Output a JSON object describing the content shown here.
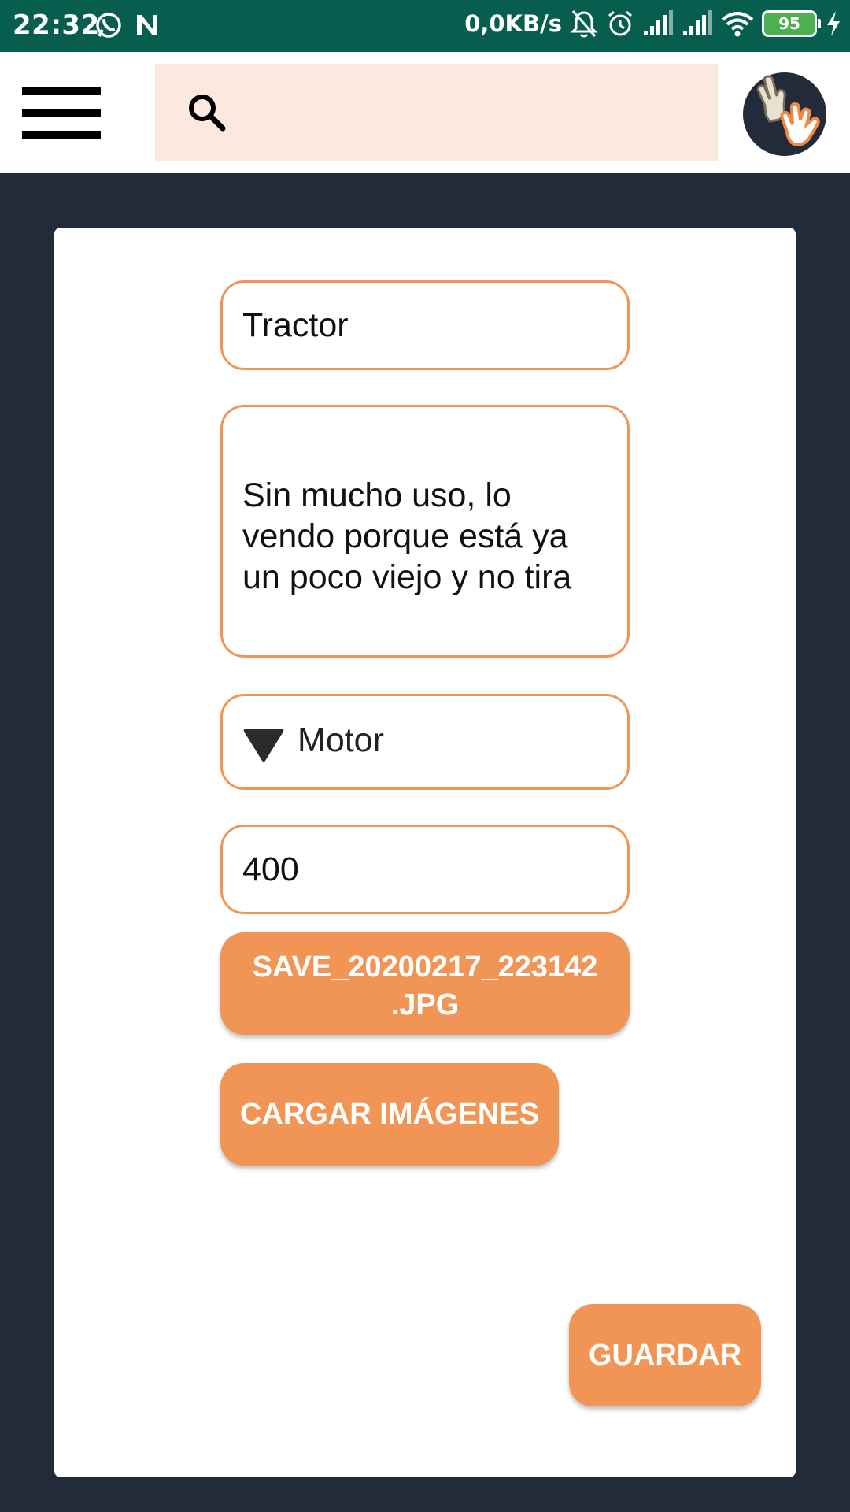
{
  "status_bar": {
    "time": "22:32",
    "network_speed": "0,0KB/s",
    "battery_level": "95",
    "icons": [
      "whatsapp-icon",
      "n-app-icon",
      "bell-off-icon",
      "alarm-icon",
      "signal-icon",
      "signal-icon",
      "wifi-icon",
      "battery-icon",
      "charging-icon"
    ]
  },
  "header": {
    "menu_icon": "hamburger-menu-icon",
    "search": {
      "icon": "search-icon",
      "value": "",
      "placeholder": ""
    },
    "avatar_icon": "hands-logo-icon"
  },
  "form": {
    "title_value": "Tractor",
    "description_value": "Sin mucho uso, lo vendo porque está ya un poco viejo y no tira",
    "category_value": "Motor",
    "price_value": "400",
    "file_button_label": "SAVE_20200217_223142 .JPG",
    "load_images_label": "CARGAR IMÁGENES",
    "save_label": "GUARDAR"
  },
  "colors": {
    "status_bar": "#075e4e",
    "background": "#212b3a",
    "accent": "#f09555",
    "search_bg": "#fbe9df"
  }
}
